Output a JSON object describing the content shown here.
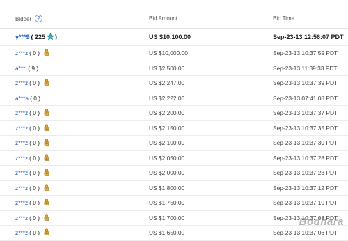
{
  "header": {
    "bidder": "Bidder",
    "help": "?",
    "amount": "Bid Amount",
    "time": "Bid Time"
  },
  "rows": [
    {
      "bidder": "y***9",
      "score": "( 225",
      "close": ")",
      "icon": "turquoise-star-icon",
      "amount": "US $10,100.00",
      "time": "Sep-23-13 12:56:07 PDT"
    },
    {
      "bidder": "z***z",
      "score": "( 0 )",
      "icon": "new-member-icon",
      "amount": "US $10,000.00",
      "time": "Sep-23-13 10:37:59 PDT"
    },
    {
      "bidder": "a***l",
      "score": "( 9 )",
      "icon": "",
      "amount": "US $2,500.00",
      "time": "Sep-23-13 11:39:33 PDT"
    },
    {
      "bidder": "z***z",
      "score": "( 0 )",
      "icon": "new-member-icon",
      "amount": "US $2,247.00",
      "time": "Sep-23-13 10:37:39 PDT"
    },
    {
      "bidder": "a***a",
      "score": "( 0 )",
      "icon": "",
      "amount": "US $2,222.00",
      "time": "Sep-23-13 07:41:08 PDT"
    },
    {
      "bidder": "z***z",
      "score": "( 0 )",
      "icon": "new-member-icon",
      "amount": "US $2,200.00",
      "time": "Sep-23-13 10:37:37 PDT"
    },
    {
      "bidder": "z***z",
      "score": "( 0 )",
      "icon": "new-member-icon",
      "amount": "US $2,150.00",
      "time": "Sep-23-13 10:37:35 PDT"
    },
    {
      "bidder": "z***z",
      "score": "( 0 )",
      "icon": "new-member-icon",
      "amount": "US $2,100.00",
      "time": "Sep-23-13 10:37:30 PDT"
    },
    {
      "bidder": "z***z",
      "score": "( 0 )",
      "icon": "new-member-icon",
      "amount": "US $2,050.00",
      "time": "Sep-23-13 10:37:28 PDT"
    },
    {
      "bidder": "z***z",
      "score": "( 0 )",
      "icon": "new-member-icon",
      "amount": "US $2,000.00",
      "time": "Sep-23-13 10:37:23 PDT"
    },
    {
      "bidder": "z***z",
      "score": "( 0 )",
      "icon": "new-member-icon",
      "amount": "US $1,800.00",
      "time": "Sep-23-13 10:37:12 PDT"
    },
    {
      "bidder": "z***z",
      "score": "( 0 )",
      "icon": "new-member-icon",
      "amount": "US $1,750.00",
      "time": "Sep-23-13 10:37:10 PDT"
    },
    {
      "bidder": "z***z",
      "score": "( 0 )",
      "icon": "new-member-icon",
      "amount": "US $1,700.00",
      "time": "Sep-23-13 10:37:08 PDT"
    },
    {
      "bidder": "z***z",
      "score": "( 0 )",
      "icon": "new-member-icon",
      "amount": "US $1,650.00",
      "time": "Sep-23-13 10:37:06 PDT"
    }
  ],
  "watermark": "Bodhara",
  "colors": {
    "link": "#1a56c5",
    "star": "#2bb3b3",
    "new_member": "#d9a520"
  }
}
